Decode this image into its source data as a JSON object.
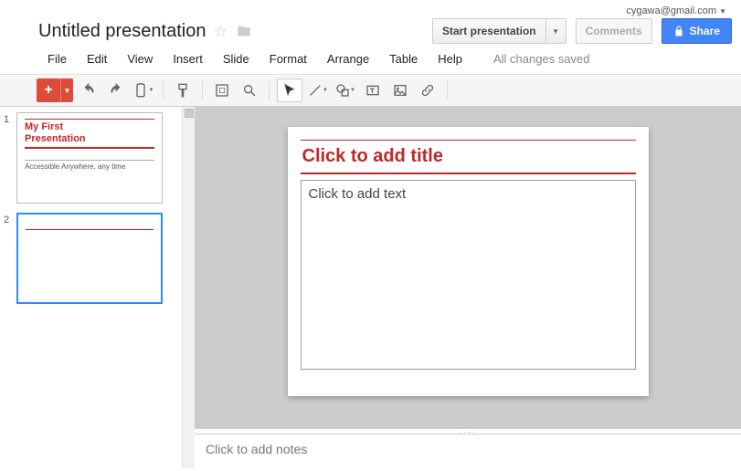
{
  "account": {
    "email": "cygawa@gmail.com"
  },
  "doc": {
    "title": "Untitled presentation"
  },
  "buttons": {
    "start_presentation": "Start presentation",
    "comments": "Comments",
    "share": "Share"
  },
  "menus": {
    "file": "File",
    "edit": "Edit",
    "view": "View",
    "insert": "Insert",
    "slide": "Slide",
    "format": "Format",
    "arrange": "Arrange",
    "table": "Table",
    "help": "Help"
  },
  "status": "All changes saved",
  "thumbnails": [
    {
      "num": "1",
      "title": "My First\nPresentation",
      "subtitle": "Accessible Anywhere, any time",
      "selected": false
    },
    {
      "num": "2",
      "title": "",
      "subtitle": "",
      "selected": true
    }
  ],
  "slide": {
    "title_placeholder": "Click to add title",
    "body_placeholder": "Click to add text"
  },
  "notes": {
    "placeholder": "Click to add notes"
  }
}
